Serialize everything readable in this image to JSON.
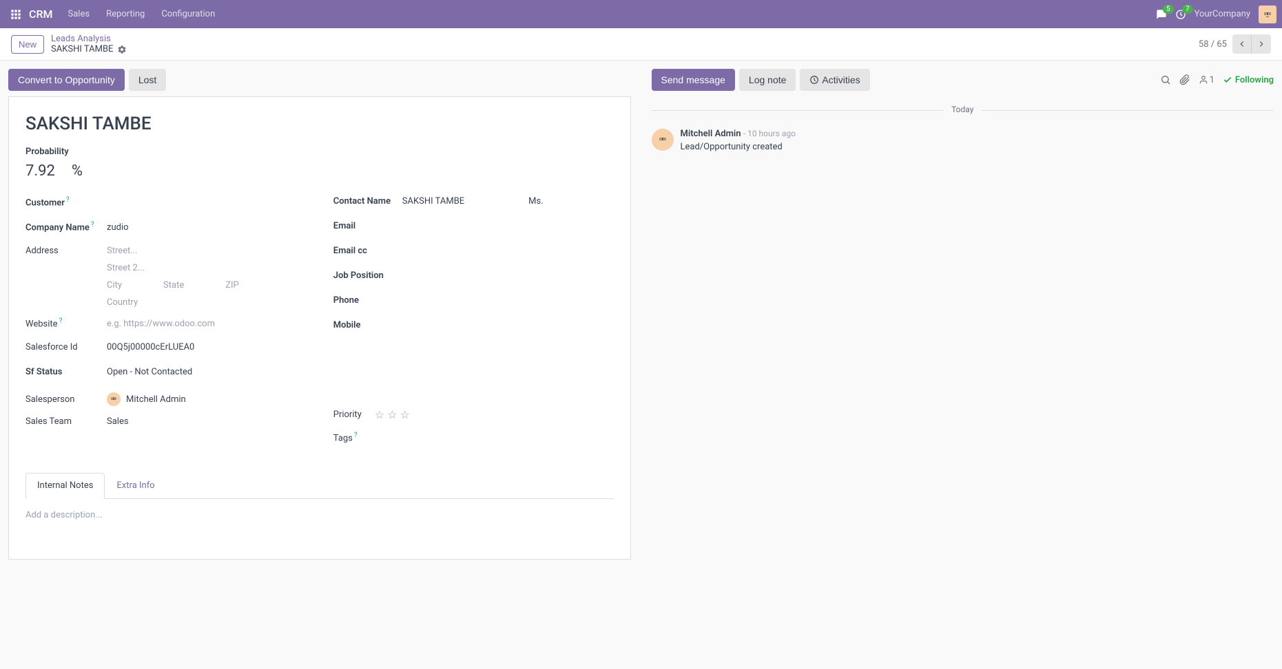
{
  "navbar": {
    "brand": "CRM",
    "menu": [
      "Sales",
      "Reporting",
      "Configuration"
    ],
    "messages_count": "5",
    "activities_count": "7",
    "company": "YourCompany"
  },
  "control_panel": {
    "new_button": "New",
    "breadcrumb_parent": "Leads Analysis",
    "breadcrumb_current": "SAKSHI TAMBE",
    "pager_current": "58",
    "pager_total": "65",
    "pager_sep": " / "
  },
  "statusbar": {
    "convert": "Convert to Opportunity",
    "lost": "Lost"
  },
  "form": {
    "title": "SAKSHI TAMBE",
    "probability_label": "Probability",
    "probability_value": "7.92",
    "probability_unit": "%",
    "left": {
      "customer_label": "Customer",
      "company_label": "Company Name",
      "company_value": "zudio",
      "address_label": "Address",
      "street_ph": "Street...",
      "street2_ph": "Street 2...",
      "city_ph": "City",
      "state_ph": "State",
      "zip_ph": "ZIP",
      "country_ph": "Country",
      "website_label": "Website",
      "website_ph": "e.g. https://www.odoo.com",
      "sfid_label": "Salesforce Id",
      "sfid_value": "00Q5j00000cErLUEA0",
      "sfstatus_label": "Sf Status",
      "sfstatus_value": "Open - Not Contacted",
      "salesperson_label": "Salesperson",
      "salesperson_value": "Mitchell Admin",
      "salesteam_label": "Sales Team",
      "salesteam_value": "Sales"
    },
    "right": {
      "contact_label": "Contact Name",
      "contact_value": "SAKSHI TAMBE",
      "title_value": "Ms.",
      "email_label": "Email",
      "emailcc_label": "Email cc",
      "job_label": "Job Position",
      "phone_label": "Phone",
      "mobile_label": "Mobile",
      "priority_label": "Priority",
      "tags_label": "Tags"
    },
    "tabs": {
      "internal_notes": "Internal Notes",
      "extra_info": "Extra Info",
      "description_ph": "Add a description..."
    }
  },
  "chatter": {
    "send_message": "Send message",
    "log_note": "Log note",
    "activities": "Activities",
    "follower_count": "1",
    "following": "Following",
    "divider": "Today",
    "message": {
      "author": "Mitchell Admin",
      "time": "- 10 hours ago",
      "body": "Lead/Opportunity created"
    }
  }
}
